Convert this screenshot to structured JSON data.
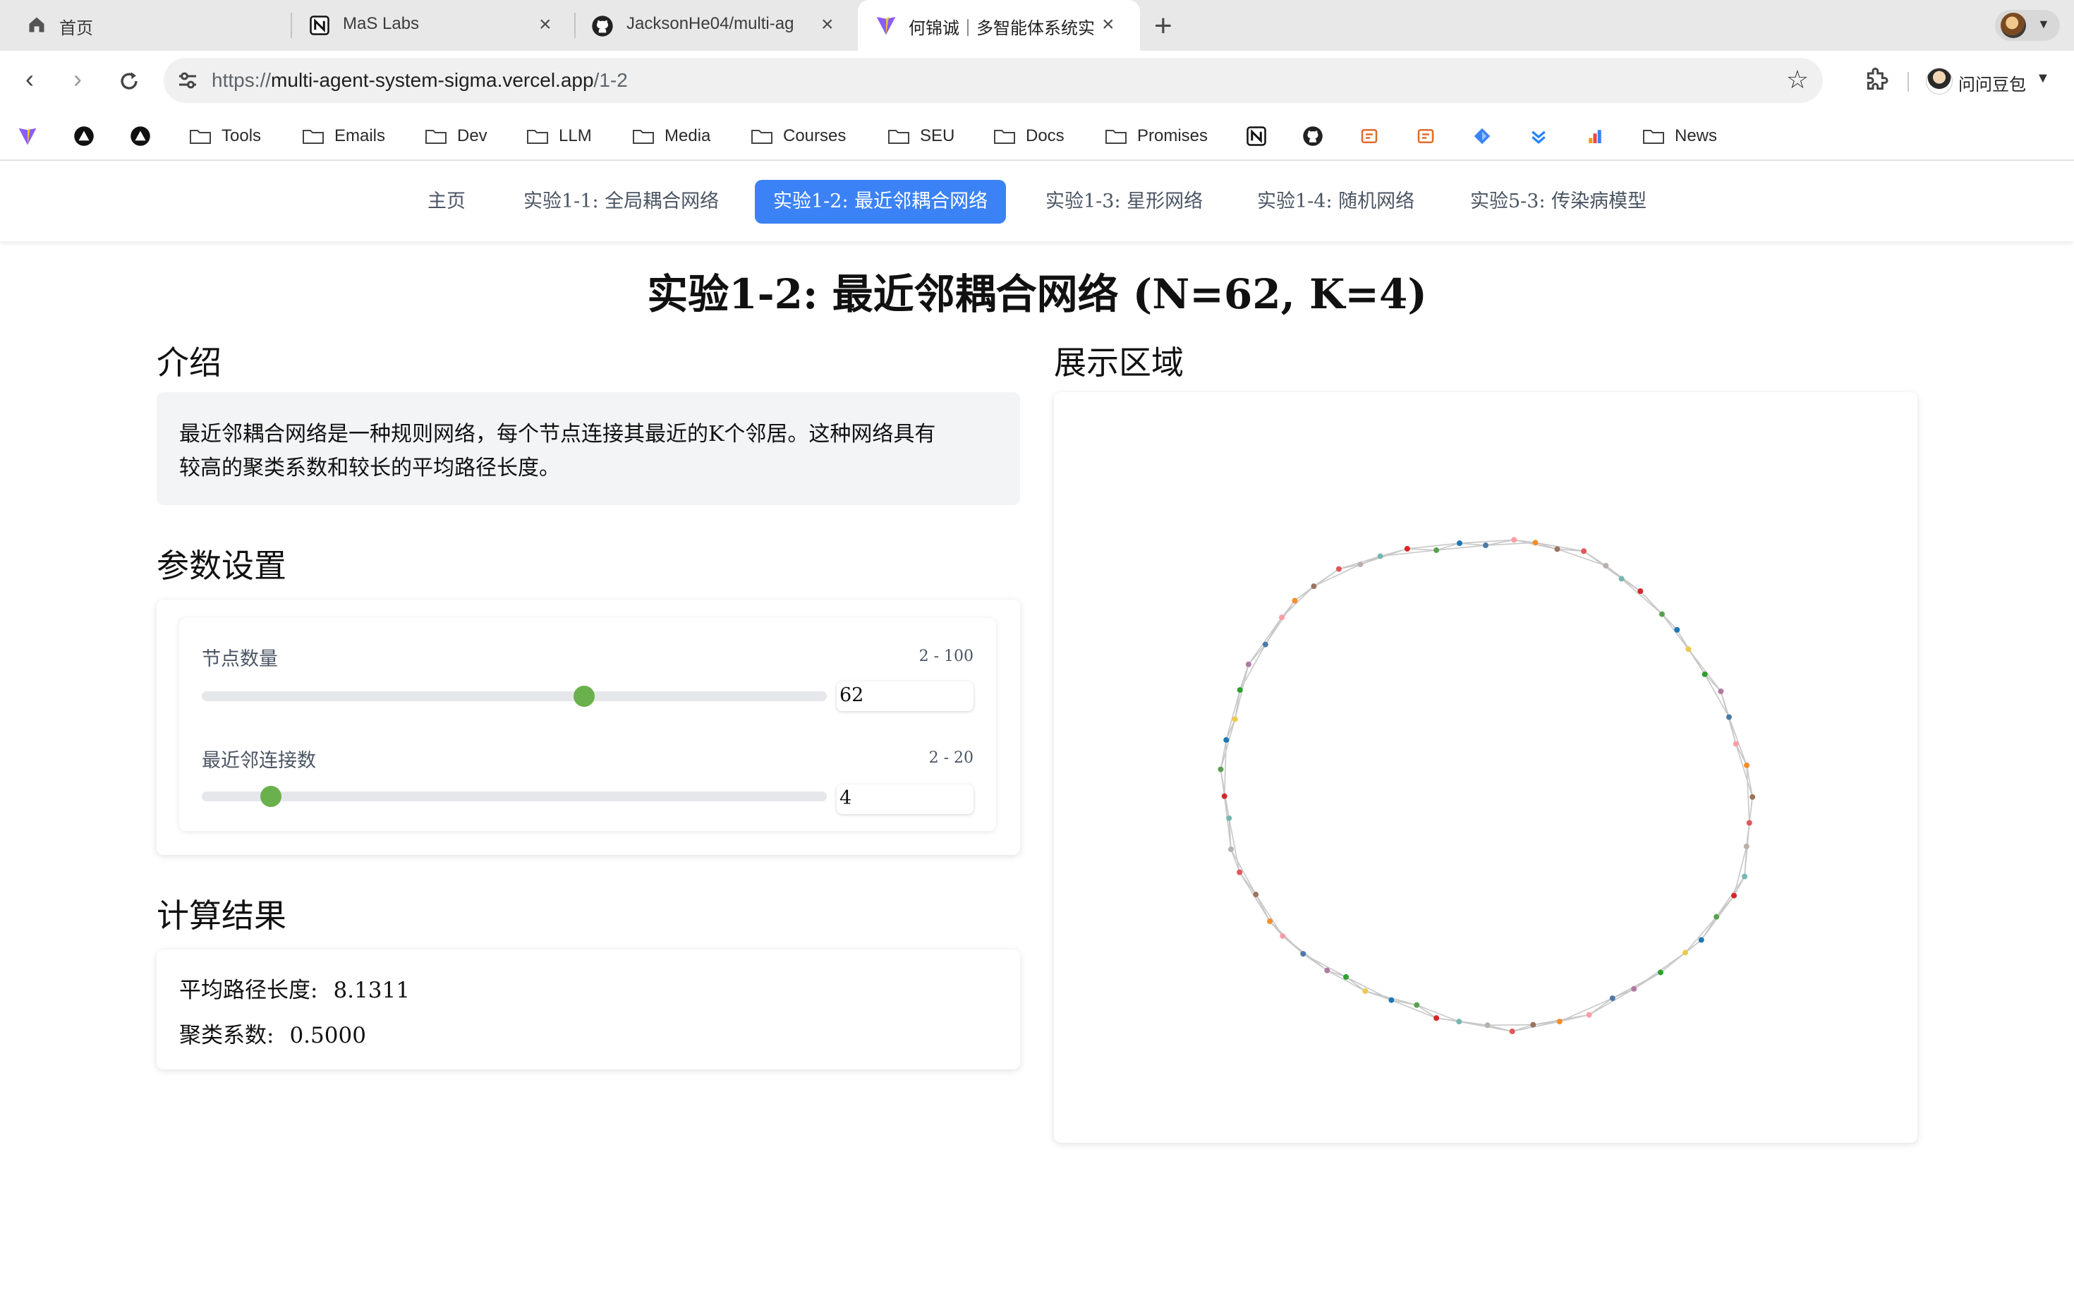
{
  "browser": {
    "tabs": [
      {
        "label": "首页",
        "icon": "home-icon"
      },
      {
        "label": "MaS Labs",
        "icon": "notion-icon"
      },
      {
        "label": "JacksonHe04/multi-ag",
        "icon": "github-icon"
      },
      {
        "label": "何锦诚｜多智能体系统实",
        "icon": "vite-icon"
      }
    ],
    "url_prefix": "https://",
    "url_host": "multi-agent-system-sigma.vercel.app",
    "url_path": "/1-2",
    "profile_name": "问问豆包",
    "bookmarks": [
      "Tools",
      "Emails",
      "Dev",
      "LLM",
      "Media",
      "Courses",
      "SEU",
      "Docs",
      "Promises",
      "News"
    ]
  },
  "nav": {
    "links": [
      "主页",
      "实验1-1: 全局耦合网络",
      "实验1-2: 最近邻耦合网络",
      "实验1-3: 星形网络",
      "实验1-4: 随机网络",
      "实验5-3: 传染病模型"
    ],
    "active_index": 2
  },
  "page": {
    "title": "实验1-2: 最近邻耦合网络 (N=62, K=4)",
    "intro_heading": "介绍",
    "intro_text_line1": "最近邻耦合网络是一种规则网络，每个节点连接其最近的K个邻居。这种网络具有",
    "intro_text_line2": "较高的聚类系数和较长的平均路径长度。",
    "params_heading": "参数设置",
    "params": {
      "nodes": {
        "label": "节点数量",
        "range": "2 - 100",
        "value": "62",
        "min": 2,
        "max": 100
      },
      "neighbors": {
        "label": "最近邻连接数",
        "range": "2 - 20",
        "value": "4",
        "min": 2,
        "max": 20
      }
    },
    "results_heading": "计算结果",
    "results": {
      "avg_path_label": "平均路径长度:",
      "avg_path_value": "8.1311",
      "clustering_label": "聚类系数:",
      "clustering_value": "0.5000"
    },
    "display_heading": "展示区域"
  },
  "graph": {
    "node_count": 62,
    "k": 4,
    "edge_color": "#c8c8c8",
    "node_colors": [
      "#4e79a7",
      "#f28e2b",
      "#e15759",
      "#76b7b2",
      "#59a14f",
      "#edc948",
      "#b07aa1",
      "#ff9da7",
      "#9c755f",
      "#bab0ac",
      "#d62728",
      "#1f77b4",
      "#2ca02c"
    ]
  },
  "colors": {
    "accent": "#3b82f6",
    "slider_knob": "#6ab04c",
    "intro_bg": "#f3f4f6"
  }
}
